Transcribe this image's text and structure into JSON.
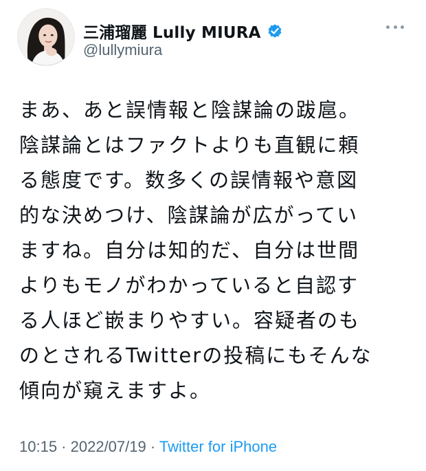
{
  "colors": {
    "text": "#0f1419",
    "secondary": "#536471",
    "link": "#1d9bf0",
    "verified_badge": "#1d9bf0"
  },
  "author": {
    "display_name": "三浦瑠麗 Lully MIURA",
    "handle": "@lullymiura",
    "avatar_icon": "user-avatar",
    "verified_icon": "verified-badge-icon"
  },
  "menu": {
    "icon": "more-icon"
  },
  "tweet": {
    "text_lines": [
      "まあ、あと誤情報と陰謀論の跋扈。",
      "陰謀論とはファクトよりも直観に頼",
      "る態度です。数多くの誤情報や意図",
      "的な決めつけ、陰謀論が広がってい",
      "ますね。自分は知的だ、自分は世間",
      "よりもモノがわかっていると自認す",
      "る人ほど嵌まりやすい。容疑者のも",
      "のとされるTwitterの投稿にもそんな",
      "傾向が窺えますよ。"
    ]
  },
  "meta": {
    "time": "10:15",
    "separator_1": " · ",
    "date": "2022/07/19",
    "separator_2": " · ",
    "source": "Twitter for iPhone"
  }
}
